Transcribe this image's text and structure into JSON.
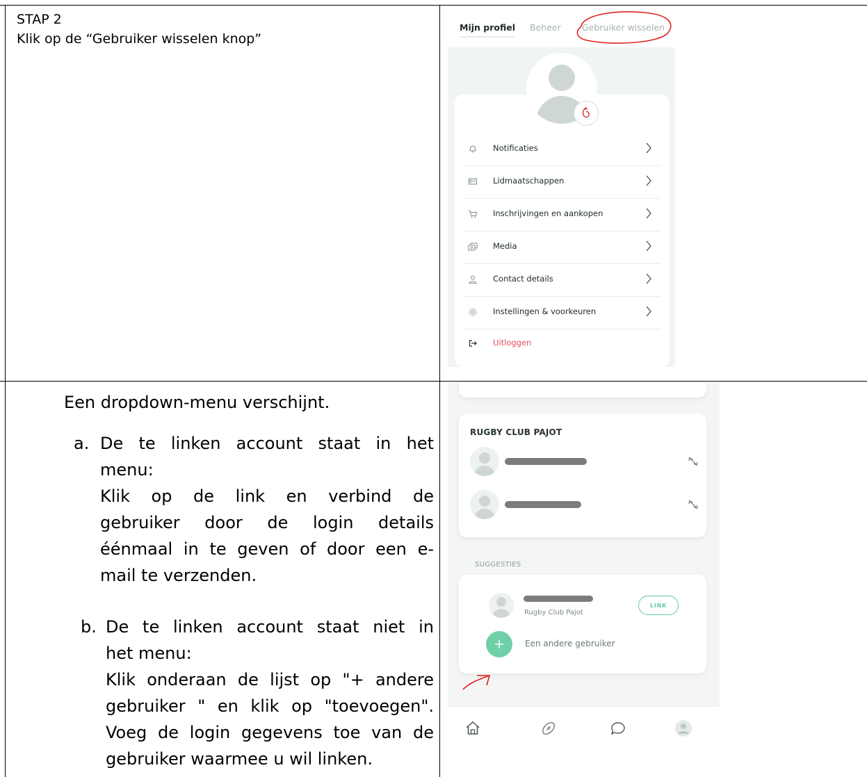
{
  "step": {
    "title": "STAP 2",
    "instruction": "Klik op de “Gebruiker wisselen knop”"
  },
  "explanation": {
    "intro": "Een dropdown-menu verschijnt.",
    "item_a": {
      "marker": "a.",
      "lines": [
        "De te linken account staat in het",
        "menu:",
        "Klik op de link en verbind de",
        "gebruiker door de login details",
        "éénmaal in te geven of door een e-",
        "mail te verzenden."
      ]
    },
    "item_b": {
      "marker": "b.",
      "lines": [
        "De te linken account staat niet in",
        "het menu:",
        "Klik onderaan de lijst op \"+ andere",
        "gebruiker \" en klik op \"toevoegen\".",
        "Voeg de login gegevens toe van de",
        "gebruiker waarmee u wil linken."
      ]
    }
  },
  "profile_screen": {
    "tabs": [
      "Mijn profiel",
      "Beheer",
      "Gebruiker wisselen"
    ],
    "menu": [
      {
        "label": "Notificaties",
        "icon": "bell-icon"
      },
      {
        "label": "Lidmaatschappen",
        "icon": "id-card-icon"
      },
      {
        "label": "Inschrijvingen en aankopen",
        "icon": "cart-icon"
      },
      {
        "label": "Media",
        "icon": "media-icon"
      },
      {
        "label": "Contact details",
        "icon": "person-icon"
      },
      {
        "label": "Instellingen & voorkeuren",
        "icon": "gear-icon"
      },
      {
        "label": "Uitloggen",
        "icon": "logout-icon"
      }
    ],
    "colors": {
      "logout": "#e0505d",
      "annotation": "#e02020"
    }
  },
  "switch_screen": {
    "club_title": "RUGBY CLUB PAJOT",
    "suggestions_label": "SUGGESTIES",
    "suggestion_club": "Rugby Club Pajot",
    "link_label": "LINK",
    "add_other_label": "Een andere gebruiker",
    "colors": {
      "accent": "#6fd0a8"
    }
  }
}
